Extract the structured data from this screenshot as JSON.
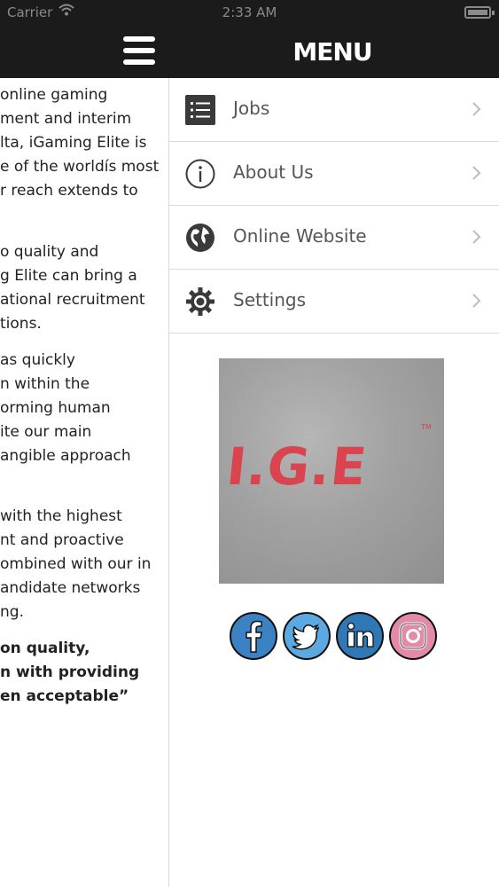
{
  "status_bar": {
    "carrier": "Carrier",
    "time": "2:33 AM"
  },
  "header": {
    "title": "MENU",
    "menu_icon": "hamburger-menu-icon"
  },
  "background_page": {
    "paragraphs": [
      "online gaming",
      "ment and interim",
      "lta, iGaming Elite is",
      "e of the worldís most",
      "r reach extends to",
      "o quality and",
      "g Elite can bring a",
      "ational recruitment",
      "tions.",
      "as quickly",
      "n within the",
      "orming human",
      "ite our main",
      "angible approach",
      "with the highest",
      "nt and proactive",
      "ombined with our in",
      "andidate networks",
      "ng.",
      "on quality,",
      "n with providing",
      "en acceptable”"
    ]
  },
  "menu": {
    "items": [
      {
        "label": "Jobs",
        "icon": "list-icon"
      },
      {
        "label": "About Us",
        "icon": "info-icon"
      },
      {
        "label": "Online Website",
        "icon": "globe-icon"
      },
      {
        "label": "Settings",
        "icon": "gear-icon"
      }
    ]
  },
  "logo": {
    "text": "I.G.E",
    "tm": "TM",
    "color": "#d9444e",
    "background": "#a8a8a8"
  },
  "social": [
    {
      "name": "facebook",
      "icon": "facebook-icon",
      "color": "#3b82c4"
    },
    {
      "name": "twitter",
      "icon": "twitter-icon",
      "color": "#5ba9e0"
    },
    {
      "name": "linkedin",
      "icon": "linkedin-icon",
      "color": "#2f78b5"
    },
    {
      "name": "instagram",
      "icon": "instagram-icon",
      "color": "#e28aa8"
    }
  ]
}
